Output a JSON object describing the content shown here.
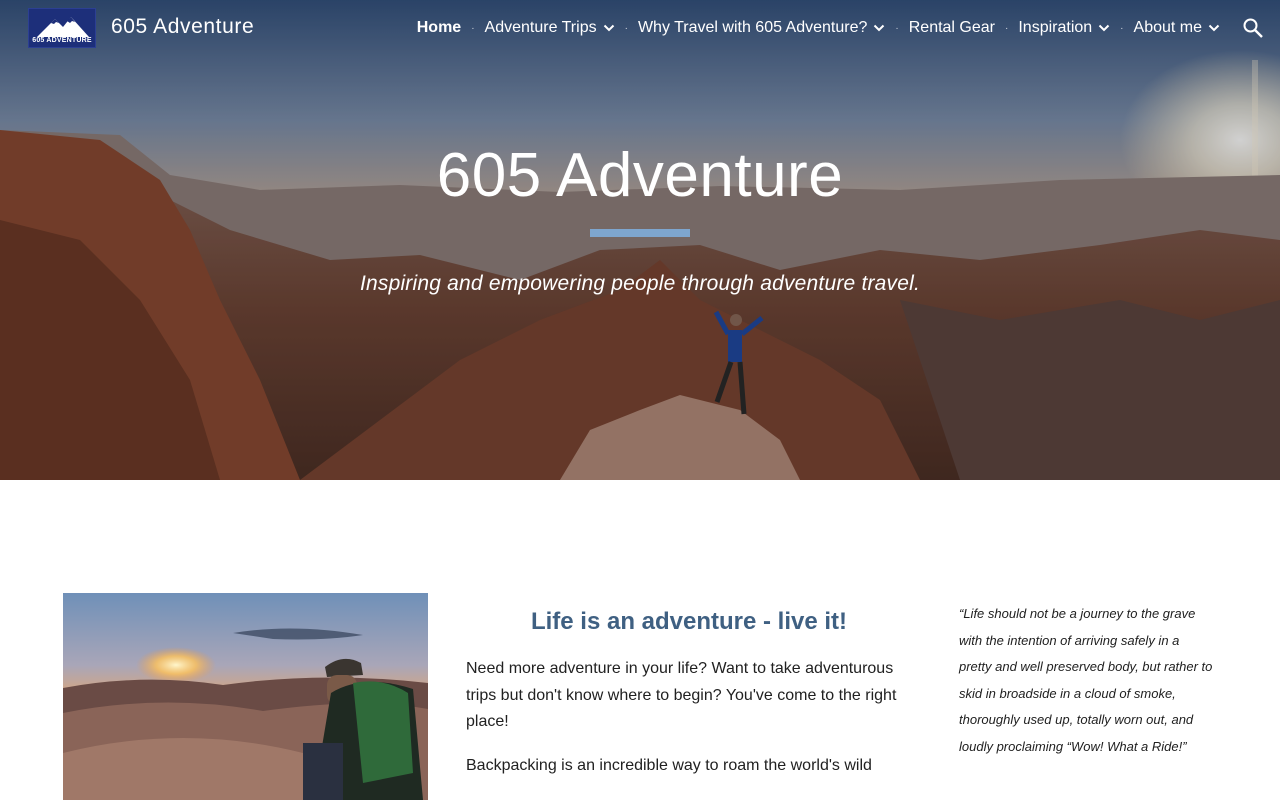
{
  "site": {
    "logo_text": "605 ADVENTURE",
    "title": "605 Adventure"
  },
  "nav": {
    "items": [
      {
        "label": "Home",
        "active": true,
        "has_dropdown": false
      },
      {
        "label": "Adventure Trips",
        "active": false,
        "has_dropdown": true
      },
      {
        "label": "Why Travel with 605 Adventure?",
        "active": false,
        "has_dropdown": true
      },
      {
        "label": "Rental Gear",
        "active": false,
        "has_dropdown": false
      },
      {
        "label": "Inspiration",
        "active": false,
        "has_dropdown": true
      },
      {
        "label": "About me",
        "active": false,
        "has_dropdown": true
      }
    ],
    "search_icon": "search-icon"
  },
  "hero": {
    "title": "605 Adventure",
    "subtitle": "Inspiring and empowering people through adventure travel.",
    "rule_color": "#7ea6cf"
  },
  "main": {
    "heading": "Life is an adventure - live it!",
    "heading_color": "#3f6082",
    "paragraph1": "Need more adventure in your life? Want to take adventurous trips but don't know where to begin?  You've come to the right place!",
    "paragraph2": "Backpacking is an incredible way to roam the world's wild"
  },
  "quote": {
    "text": "“Life should not be a journey to the grave with the intention of arriving safely in a pretty and well preserved body, but rather to skid in broadside in a cloud of smoke, thoroughly used up, totally worn out, and loudly proclaiming “Wow! What a Ride!”"
  }
}
